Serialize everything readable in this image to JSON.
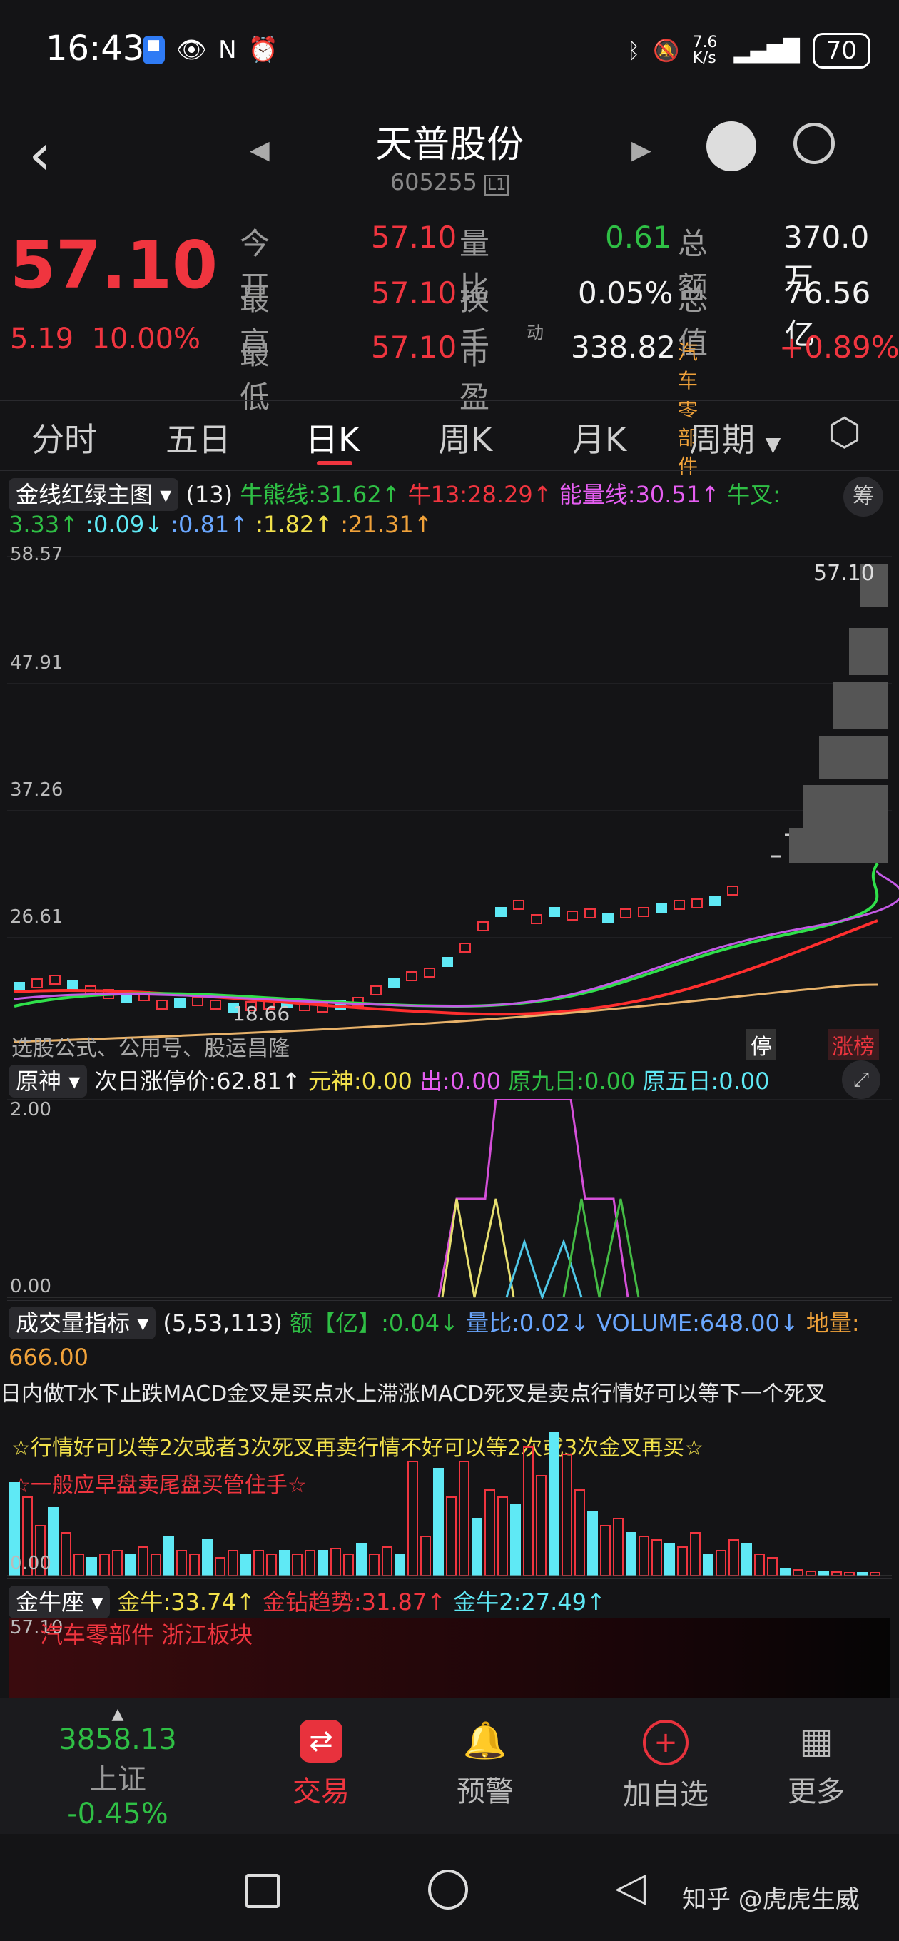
{
  "status": {
    "time": "16:43",
    "net_speed": "7.6 K/s",
    "battery": "70"
  },
  "nav": {
    "title": "天普股份",
    "code": "605255",
    "badge": "L1"
  },
  "quote": {
    "price": "57.10",
    "change": "5.19",
    "change_pct": "10.00%",
    "rows": [
      {
        "l1": "今开",
        "v1": "57.10",
        "l2": "量比",
        "v2": "0.61",
        "l3": "总额",
        "v3": "370.0万"
      },
      {
        "l1": "最高",
        "v1": "57.10",
        "l2": "换手",
        "v2": "0.05%",
        "l3": "总值",
        "v3": "76.56亿"
      },
      {
        "l1": "最低",
        "v1": "57.10",
        "l2": "市盈",
        "v2": "338.82",
        "l3": "汽车零部件",
        "v3": "+0.89%"
      }
    ],
    "pe_mark": "动"
  },
  "tabs": [
    "分时",
    "五日",
    "日K",
    "周K",
    "月K",
    "周期"
  ],
  "main_ind": {
    "name": "金线红绿主图",
    "p": "(13)",
    "items": [
      "牛熊线:31.62↑",
      "牛13:28.29↑",
      "能量线:30.51↑",
      "牛叉:"
    ],
    "items2": [
      "3.33↑",
      ":0.09↓",
      ":0.81↑",
      ":1.82↑",
      ":21.31↑"
    ],
    "chou": "筹"
  },
  "price_axis": [
    "58.57",
    "47.91",
    "37.26",
    "26.61"
  ],
  "last_price": "57.10",
  "low_label": "18.66",
  "wm_text": "选股公式、公用号、股运昌隆",
  "tags": {
    "stop": "停",
    "rank": "涨榜"
  },
  "ind2": {
    "name": "原神",
    "items": [
      "次日涨停价:62.81↑",
      "元神:0.00",
      "出:0.00",
      "原九日:0.00",
      "原五日:0.00"
    ],
    "axis": [
      "2.00",
      "0.00"
    ]
  },
  "ind3": {
    "name": "成交量指标",
    "p": "(5,53,113)",
    "items": [
      "额【亿】:0.04↓",
      "量比:0.02↓",
      "VOLUME:648.00↓",
      "地量:"
    ],
    "item2": "666.00",
    "line1": "日内做T水下止跌MACD金叉是买点水上滞涨MACD死叉是卖点行情好可以等下一个死叉",
    "line2": "☆行情好可以等2次或者3次死叉再卖行情不好可以等2次或3次金叉再买☆",
    "line3": "☆一般应早盘卖尾盘买管住手☆",
    "axis": "0.00"
  },
  "ind4": {
    "name": "金牛座",
    "items": [
      "金牛:33.74↑",
      "金钻趋势:31.87↑",
      "金牛2:27.49↑"
    ],
    "axis": "57.10",
    "banner": "汽车零部件 浙江板块"
  },
  "bottom": {
    "index_value": "3858.13",
    "index_name": "上证",
    "index_chg": "-0.45%",
    "trade": "交易",
    "alert": "预警",
    "add": "加自选",
    "more": "更多"
  },
  "watermark": "知乎 @虎虎生威",
  "colors": {
    "up": "#f0353f",
    "down": "#2fbf45",
    "bg": "#141416"
  }
}
